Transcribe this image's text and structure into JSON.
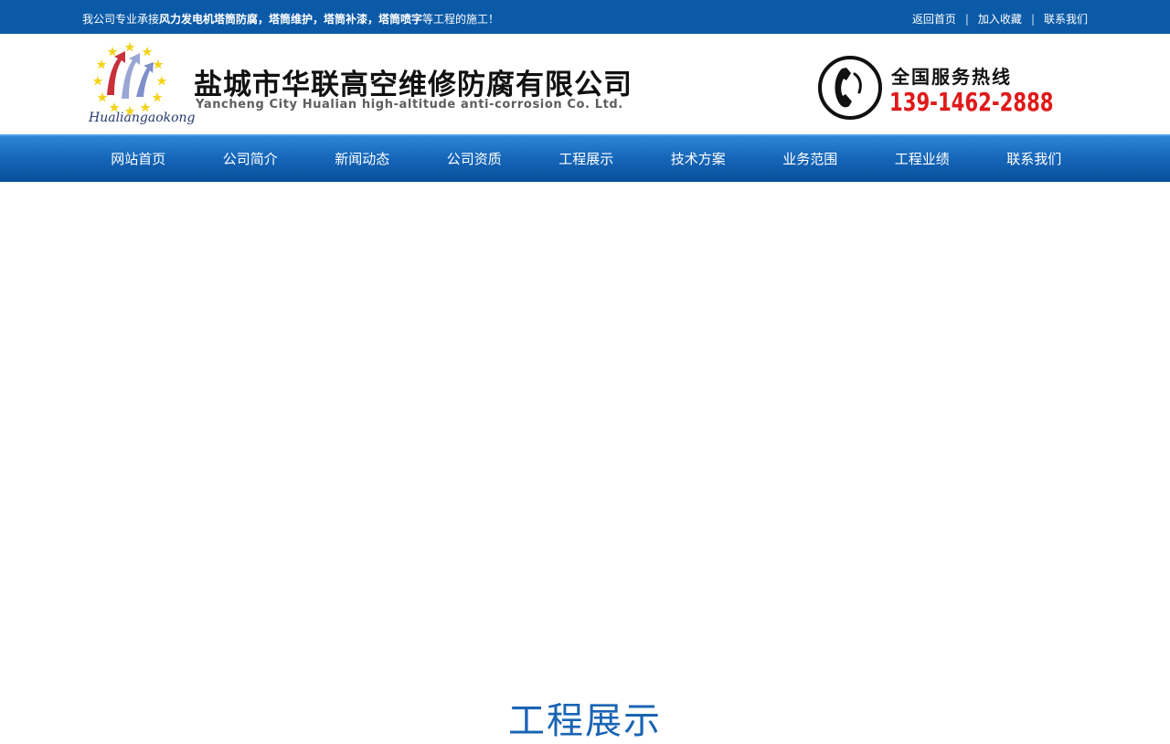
{
  "topbar": {
    "slogan_prefix": "我公司专业承接",
    "slogan_bold": "风力发电机塔筒防腐，塔筒维护，塔筒补漆，塔筒喷字",
    "slogan_suffix": "等工程的施工！",
    "links": [
      "返回首页",
      "加入收藏",
      "联系我们"
    ],
    "separator": "|"
  },
  "header": {
    "logo_text": "Hualiangaokong",
    "company_cn": "盐城市华联高空维修防腐有限公司",
    "company_en": "Yancheng City Hualian high-altitude anti-corrosion Co. Ltd.",
    "hotline_label": "全国服务热线",
    "hotline_number": "139-1462-2888"
  },
  "nav": {
    "items": [
      "网站首页",
      "公司简介",
      "新闻动态",
      "公司资质",
      "工程展示",
      "技术方案",
      "业务范围",
      "工程业绩",
      "联系我们"
    ]
  },
  "section": {
    "title": "工程展示"
  },
  "colors": {
    "brand_blue": "#0a5aa8",
    "hotline_red": "#e01a1a"
  }
}
